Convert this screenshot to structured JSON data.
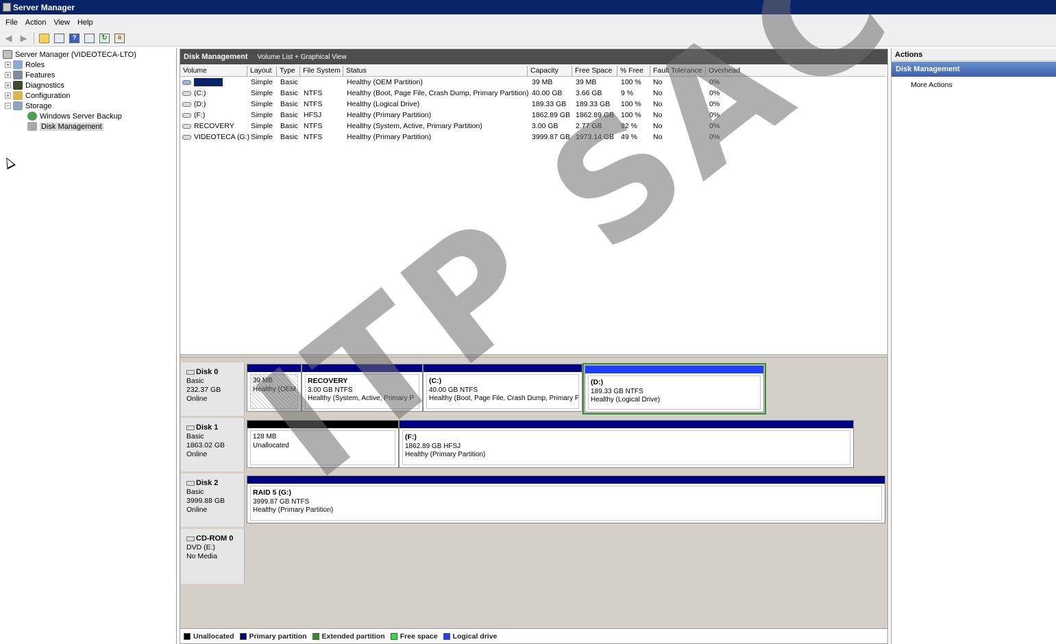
{
  "window": {
    "title": "Server Manager"
  },
  "menu": [
    "File",
    "Action",
    "View",
    "Help"
  ],
  "tree": {
    "root": "Server Manager (VIDEOTECA-LTO)",
    "items": [
      "Roles",
      "Features",
      "Diagnostics",
      "Configuration",
      "Storage"
    ],
    "storage_children": [
      "Windows Server Backup",
      "Disk Management"
    ]
  },
  "panel": {
    "title": "Disk Management",
    "subtitle": "Volume List + Graphical View"
  },
  "columns": [
    "Volume",
    "Layout",
    "Type",
    "File System",
    "Status",
    "Capacity",
    "Free Space",
    "% Free",
    "Fault Tolerance",
    "Overhead"
  ],
  "volumes": [
    {
      "volume": "",
      "layout": "Simple",
      "type": "Basic",
      "fs": "",
      "status": "Healthy (OEM Partition)",
      "capacity": "39 MB",
      "free": "39 MB",
      "pct": "100 %",
      "ft": "No",
      "overhead": "0%"
    },
    {
      "volume": "(C:)",
      "layout": "Simple",
      "type": "Basic",
      "fs": "NTFS",
      "status": "Healthy (Boot, Page File, Crash Dump, Primary Partition)",
      "capacity": "40.00 GB",
      "free": "3.66 GB",
      "pct": "9 %",
      "ft": "No",
      "overhead": "0%"
    },
    {
      "volume": "(D:)",
      "layout": "Simple",
      "type": "Basic",
      "fs": "NTFS",
      "status": "Healthy (Logical Drive)",
      "capacity": "189.33 GB",
      "free": "189.33 GB",
      "pct": "100 %",
      "ft": "No",
      "overhead": "0%"
    },
    {
      "volume": "(F:)",
      "layout": "Simple",
      "type": "Basic",
      "fs": "HFSJ",
      "status": "Healthy (Primary Partition)",
      "capacity": "1862.89 GB",
      "free": "1862.89 GB",
      "pct": "100 %",
      "ft": "No",
      "overhead": "0%"
    },
    {
      "volume": "RECOVERY",
      "layout": "Simple",
      "type": "Basic",
      "fs": "NTFS",
      "status": "Healthy (System, Active, Primary Partition)",
      "capacity": "3.00 GB",
      "free": "2.77 GB",
      "pct": "92 %",
      "ft": "No",
      "overhead": "0%"
    },
    {
      "volume": "VIDEOTECA (G:)",
      "layout": "Simple",
      "type": "Basic",
      "fs": "NTFS",
      "status": "Healthy (Primary Partition)",
      "capacity": "3999.87 GB",
      "free": "1973.14 GB",
      "pct": "49 %",
      "ft": "No",
      "overhead": "0%"
    }
  ],
  "disks": [
    {
      "name": "Disk 0",
      "type": "Basic",
      "size": "232.37 GB",
      "state": "Online",
      "parts": [
        {
          "title": "",
          "line1": "39 MB",
          "line2": "Healthy (OEM"
        },
        {
          "title": "RECOVERY",
          "line1": "3.00 GB NTFS",
          "line2": "Healthy (System, Active, Primary P"
        },
        {
          "title": "(C:)",
          "line1": "40.00 GB NTFS",
          "line2": "Healthy (Boot, Page File, Crash Dump, Primary P"
        },
        {
          "title": "(D:)",
          "line1": "189.33 GB NTFS",
          "line2": "Healthy (Logical Drive)"
        }
      ]
    },
    {
      "name": "Disk 1",
      "type": "Basic",
      "size": "1863.02 GB",
      "state": "Online",
      "parts": [
        {
          "title": "",
          "line1": "128 MB",
          "line2": "Unallocated"
        },
        {
          "title": "(F:)",
          "line1": "1862.89 GB HFSJ",
          "line2": "Healthy (Primary Partition)"
        }
      ]
    },
    {
      "name": "Disk 2",
      "type": "Basic",
      "size": "3999.88 GB",
      "state": "Online",
      "parts": [
        {
          "title": "RAID 5 (G:)",
          "line1": "3999.87 GB NTFS",
          "line2": "Healthy (Primary Partition)"
        }
      ]
    },
    {
      "name": "CD-ROM 0",
      "type": "DVD (E:)",
      "size": "",
      "state": "No Media",
      "parts": []
    }
  ],
  "legend": [
    {
      "label": "Unallocated",
      "color": "#000000"
    },
    {
      "label": "Primary partition",
      "color": "#000080"
    },
    {
      "label": "Extended partition",
      "color": "#2e8b2e"
    },
    {
      "label": "Free space",
      "color": "#33dd33"
    },
    {
      "label": "Logical drive",
      "color": "#1f3fff"
    }
  ],
  "actions": {
    "header": "Actions",
    "section": "Disk Management",
    "items": [
      "More Actions"
    ]
  },
  "watermark": "ITP SAC"
}
